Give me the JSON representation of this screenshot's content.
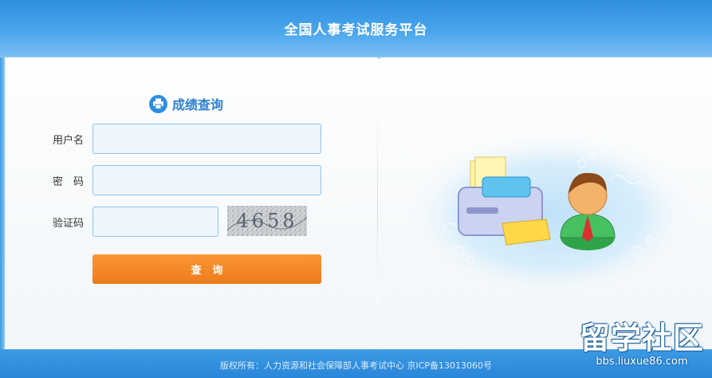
{
  "header": {
    "title": "全国人事考试服务平台"
  },
  "form": {
    "title": "成绩查询",
    "title_icon": "printer-icon",
    "username_label": "用户名",
    "username_value": "",
    "password_label": "密　码",
    "password_value": "",
    "captcha_label": "验证码",
    "captcha_value": "",
    "captcha_image_text": "4658",
    "submit_label": "查询"
  },
  "illustration": {
    "icons": [
      "printer-icon",
      "user-avatar-icon"
    ]
  },
  "footer": {
    "copyright": "版权所有：人力资源和社会保障部人事考试中心 京ICP备13013060号"
  },
  "watermark": {
    "main": "留学社区",
    "url": "bbs.liuxue86.com"
  },
  "colors": {
    "header_blue": "#2f8fe0",
    "title_blue": "#2a7fd0",
    "submit_orange": "#f48a28",
    "footer_blue": "#3390e0"
  }
}
